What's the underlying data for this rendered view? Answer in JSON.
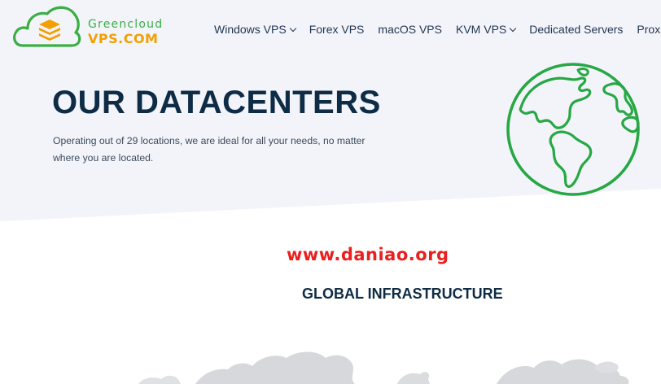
{
  "header": {
    "logo": {
      "top_text": "Greencloud",
      "bottom_text": "VPS.COM"
    },
    "nav": [
      {
        "label": "Windows VPS",
        "dropdown": true
      },
      {
        "label": "Forex VPS",
        "dropdown": false
      },
      {
        "label": "macOS VPS",
        "dropdown": false
      },
      {
        "label": "KVM VPS",
        "dropdown": true
      },
      {
        "label": "Dedicated Servers",
        "dropdown": false
      },
      {
        "label": "Proxie",
        "dropdown": false
      }
    ]
  },
  "hero": {
    "title": "OUR DATACENTERS",
    "subtitle_line1": "Operating out of 29 locations, we are ideal for all your needs, no matter",
    "subtitle_line2": "where you are located."
  },
  "watermark": "www.daniao.org",
  "section": {
    "title": "GLOBAL INFRASTRUCTURE"
  },
  "colors": {
    "brand_green": "#3aae43",
    "brand_orange": "#f2a000",
    "heading_navy": "#0e2c45",
    "hero_background": "#f3f4fa",
    "watermark_red": "#e8201f"
  },
  "icons": [
    "cloud-logo-icon",
    "chevron-down-icon",
    "globe-icon",
    "world-map-icon"
  ]
}
